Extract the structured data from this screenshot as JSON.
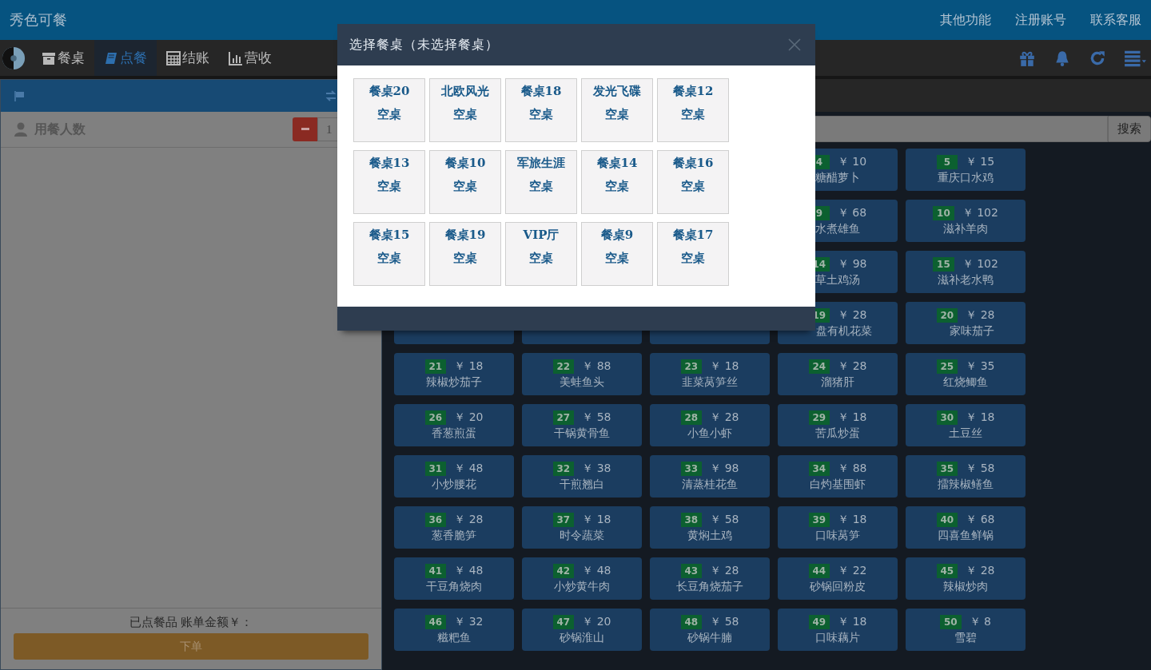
{
  "header": {
    "title": "秀色可餐",
    "links": [
      "其他功能",
      "注册账号",
      "联系客服"
    ]
  },
  "nav": {
    "tabs": [
      {
        "label": "餐桌",
        "selected": false
      },
      {
        "label": "点餐",
        "selected": true
      },
      {
        "label": "结账",
        "selected": false
      },
      {
        "label": "营收",
        "selected": false
      }
    ]
  },
  "order_panel": {
    "guests_label": "用餐人数",
    "guests": "1",
    "summary": "已点餐品 账单金额￥：",
    "submit": "下单"
  },
  "menu": {
    "search_button": "搜索",
    "dish_rows": [
      [
        {
          "kind": "dish",
          "number": "4",
          "price": "￥ 10",
          "name": "糖醋萝卜"
        },
        {
          "kind": "dish",
          "number": "5",
          "price": "￥ 15",
          "name": "重庆口水鸡"
        }
      ],
      [
        {
          "kind": "dish",
          "number": "9",
          "price": "￥ 68",
          "name": "水煮雄鱼"
        },
        {
          "kind": "dish",
          "number": "10",
          "price": "￥ 102",
          "name": "滋补羊肉"
        }
      ],
      [
        {
          "kind": "dish",
          "number": "14",
          "price": "￥ 98",
          "name": "草土鸡汤"
        },
        {
          "kind": "dish",
          "number": "15",
          "price": "￥ 102",
          "name": "滋补老水鸭"
        }
      ],
      [
        {
          "kind": "covered"
        },
        {
          "kind": "covered"
        },
        {
          "kind": "covered"
        },
        {
          "kind": "dish",
          "number": "19",
          "price": "￥ 28",
          "name": "盘有机花菜"
        },
        {
          "kind": "dish",
          "number": "20",
          "price": "￥ 28",
          "name": "家味茄子"
        }
      ],
      [
        {
          "kind": "dish",
          "number": "21",
          "price": "￥ 18",
          "name": "辣椒炒茄子"
        },
        {
          "kind": "dish",
          "number": "22",
          "price": "￥ 88",
          "name": "美蛙鱼头"
        },
        {
          "kind": "dish",
          "number": "23",
          "price": "￥ 18",
          "name": "韭菜莴笋丝"
        },
        {
          "kind": "dish",
          "number": "24",
          "price": "￥ 28",
          "name": "溜猪肝"
        },
        {
          "kind": "dish",
          "number": "25",
          "price": "￥ 35",
          "name": "红烧鲫鱼"
        }
      ],
      [
        {
          "kind": "dish",
          "number": "26",
          "price": "￥ 20",
          "name": "香葱煎蛋"
        },
        {
          "kind": "dish",
          "number": "27",
          "price": "￥ 58",
          "name": "干锅黄骨鱼"
        },
        {
          "kind": "dish",
          "number": "28",
          "price": "￥ 28",
          "name": "小鱼小虾"
        },
        {
          "kind": "dish",
          "number": "29",
          "price": "￥ 18",
          "name": "苦瓜炒蛋"
        },
        {
          "kind": "dish",
          "number": "30",
          "price": "￥ 18",
          "name": "土豆丝"
        }
      ],
      [
        {
          "kind": "dish",
          "number": "31",
          "price": "￥ 48",
          "name": "小炒腰花"
        },
        {
          "kind": "dish",
          "number": "32",
          "price": "￥ 38",
          "name": "干煎翘白"
        },
        {
          "kind": "dish",
          "number": "33",
          "price": "￥ 98",
          "name": "清蒸桂花鱼"
        },
        {
          "kind": "dish",
          "number": "34",
          "price": "￥ 88",
          "name": "白灼基围虾"
        },
        {
          "kind": "dish",
          "number": "35",
          "price": "￥ 58",
          "name": "擂辣椒鳝鱼"
        }
      ],
      [
        {
          "kind": "dish",
          "number": "36",
          "price": "￥ 28",
          "name": "葱香脆笋"
        },
        {
          "kind": "dish",
          "number": "37",
          "price": "￥ 18",
          "name": "时令蔬菜"
        },
        {
          "kind": "dish",
          "number": "38",
          "price": "￥ 58",
          "name": "黄焖土鸡"
        },
        {
          "kind": "dish",
          "number": "39",
          "price": "￥ 18",
          "name": "口味莴笋"
        },
        {
          "kind": "dish",
          "number": "40",
          "price": "￥ 68",
          "name": "四喜鱼鲜锅"
        }
      ],
      [
        {
          "kind": "dish",
          "number": "41",
          "price": "￥ 48",
          "name": "干豆角烧肉"
        },
        {
          "kind": "dish",
          "number": "42",
          "price": "￥ 48",
          "name": "小炒黄牛肉"
        },
        {
          "kind": "dish",
          "number": "43",
          "price": "￥ 28",
          "name": "长豆角烧茄子"
        },
        {
          "kind": "dish",
          "number": "44",
          "price": "￥ 22",
          "name": "砂锅回粉皮"
        },
        {
          "kind": "dish",
          "number": "45",
          "price": "￥ 28",
          "name": "辣椒炒肉"
        }
      ],
      [
        {
          "kind": "dish",
          "number": "46",
          "price": "￥ 32",
          "name": "糍粑鱼"
        },
        {
          "kind": "dish",
          "number": "47",
          "price": "￥ 20",
          "name": "砂锅淮山"
        },
        {
          "kind": "dish",
          "number": "48",
          "price": "￥ 58",
          "name": "砂锅牛腩"
        },
        {
          "kind": "dish",
          "number": "49",
          "price": "￥ 18",
          "name": "口味藕片"
        },
        {
          "kind": "dish",
          "number": "50",
          "price": "￥ 8",
          "name": "雪碧"
        }
      ]
    ]
  },
  "modal": {
    "title": "选择餐桌（未选择餐桌）",
    "tables": [
      {
        "name": "餐桌20",
        "status": "空桌"
      },
      {
        "name": "北欧风光",
        "status": "空桌"
      },
      {
        "name": "餐桌18",
        "status": "空桌"
      },
      {
        "name": "发光飞碟",
        "status": "空桌"
      },
      {
        "name": "餐桌12",
        "status": "空桌"
      },
      {
        "name": "餐桌13",
        "status": "空桌"
      },
      {
        "name": "餐桌10",
        "status": "空桌"
      },
      {
        "name": "军旅生涯",
        "status": "空桌"
      },
      {
        "name": "餐桌14",
        "status": "空桌"
      },
      {
        "name": "餐桌16",
        "status": "空桌"
      },
      {
        "name": "餐桌15",
        "status": "空桌"
      },
      {
        "name": "餐桌19",
        "status": "空桌"
      },
      {
        "name": "VIP厅",
        "status": "空桌"
      },
      {
        "name": "餐桌9",
        "status": "空桌"
      },
      {
        "name": "餐桌17",
        "status": "空桌"
      }
    ]
  }
}
